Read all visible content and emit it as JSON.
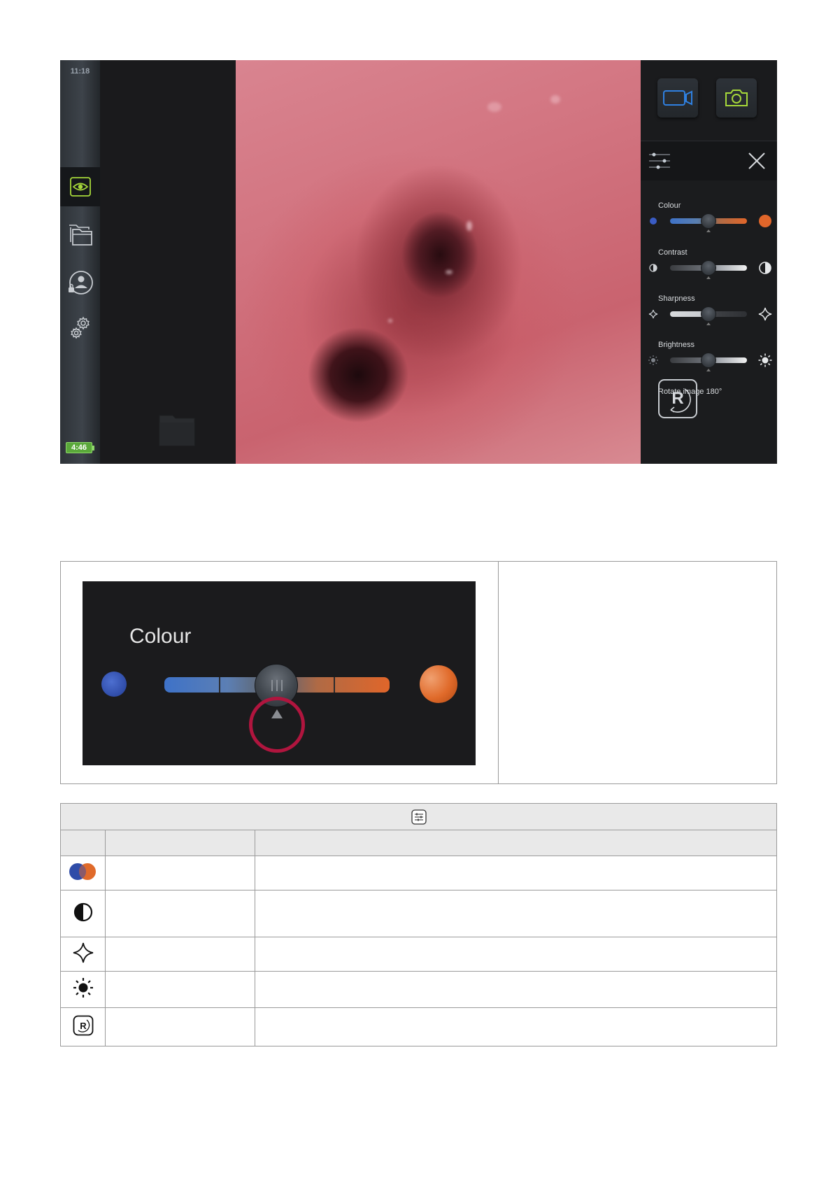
{
  "screen": {
    "clock": "11:18",
    "battery": "4:46",
    "sidebar_icons": [
      "eye-icon",
      "folder-icon",
      "user-lock-icon",
      "gear-icon"
    ],
    "sliders": [
      {
        "label": "Colour",
        "level": 0.5
      },
      {
        "label": "Contrast",
        "level": 0.5
      },
      {
        "label": "Sharpness",
        "level": 0.5
      },
      {
        "label": "Brightness",
        "level": 0.5
      }
    ],
    "rotate_label": "Rotate image 180°",
    "rotate_button_text": "R",
    "colors": {
      "accent_green": "#a6d83a",
      "record_blue": "#2f80e0",
      "highlight_red": "#b0153e"
    }
  },
  "zoom": {
    "title": "Colour",
    "level": 0.5
  },
  "table": {
    "header_icon": "settings-sliders-icon",
    "rows": [
      {
        "icon": "colour-icon"
      },
      {
        "icon": "contrast-icon"
      },
      {
        "icon": "sharpness-icon"
      },
      {
        "icon": "brightness-icon"
      },
      {
        "icon": "rotate-icon",
        "icon_text": "R"
      }
    ]
  }
}
